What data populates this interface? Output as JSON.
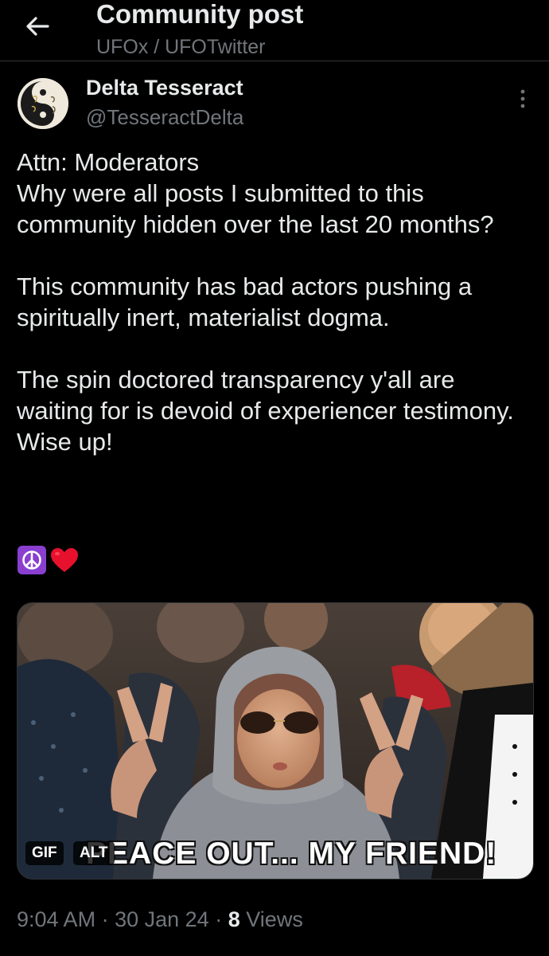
{
  "header": {
    "title": "Community post",
    "subtitle": "UFOx / UFOTwitter",
    "back_icon": "arrow-left-icon"
  },
  "author": {
    "name": "Delta Tesseract",
    "handle": "@TesseractDelta",
    "more_icon": "more-vertical-icon"
  },
  "post": {
    "paragraphs": [
      "Attn: Moderators\nWhy were all posts I submitted to this community hidden over the last 20 months?",
      "This community has bad actors pushing a spiritually inert, materialist dogma.",
      "The spin doctored transparency y'all are waiting for is devoid of experiencer testimony. Wise up!"
    ],
    "emojis": [
      "peace-symbol-icon",
      "red-heart-icon"
    ]
  },
  "media": {
    "gif_badge": "GIF",
    "alt_badge": "ALT",
    "caption": "PEACE OUT... MY FRIEND!"
  },
  "meta": {
    "time": "9:04 AM",
    "separator": "·",
    "date": "30 Jan 24",
    "views_count": "8",
    "views_label": "Views"
  },
  "colors": {
    "background": "#000000",
    "primary_text": "#e7e9ea",
    "secondary_text": "#71767b",
    "divider": "#2f3336"
  }
}
